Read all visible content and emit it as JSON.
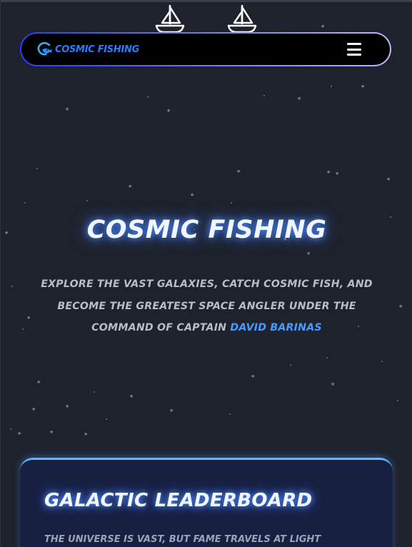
{
  "brand": {
    "name": "Cosmic Fishing",
    "logo_icon": "fish-hook-logo-icon",
    "color": "#2a7dff"
  },
  "nav": {
    "menu_icon": "hamburger-menu-icon"
  },
  "decor": {
    "top_icons": [
      "sailboat-icon",
      "sailboat-icon"
    ]
  },
  "hero": {
    "title": "Cosmic Fishing",
    "description": "Explore the vast galaxies, catch cosmic fish, and become the greatest space angler under the command of Captain",
    "captain": "David Barinas",
    "accent": "#4a9bff"
  },
  "leaderboard": {
    "title": "Galactic Leaderboard",
    "text": "The universe is vast, but fame travels at light"
  }
}
